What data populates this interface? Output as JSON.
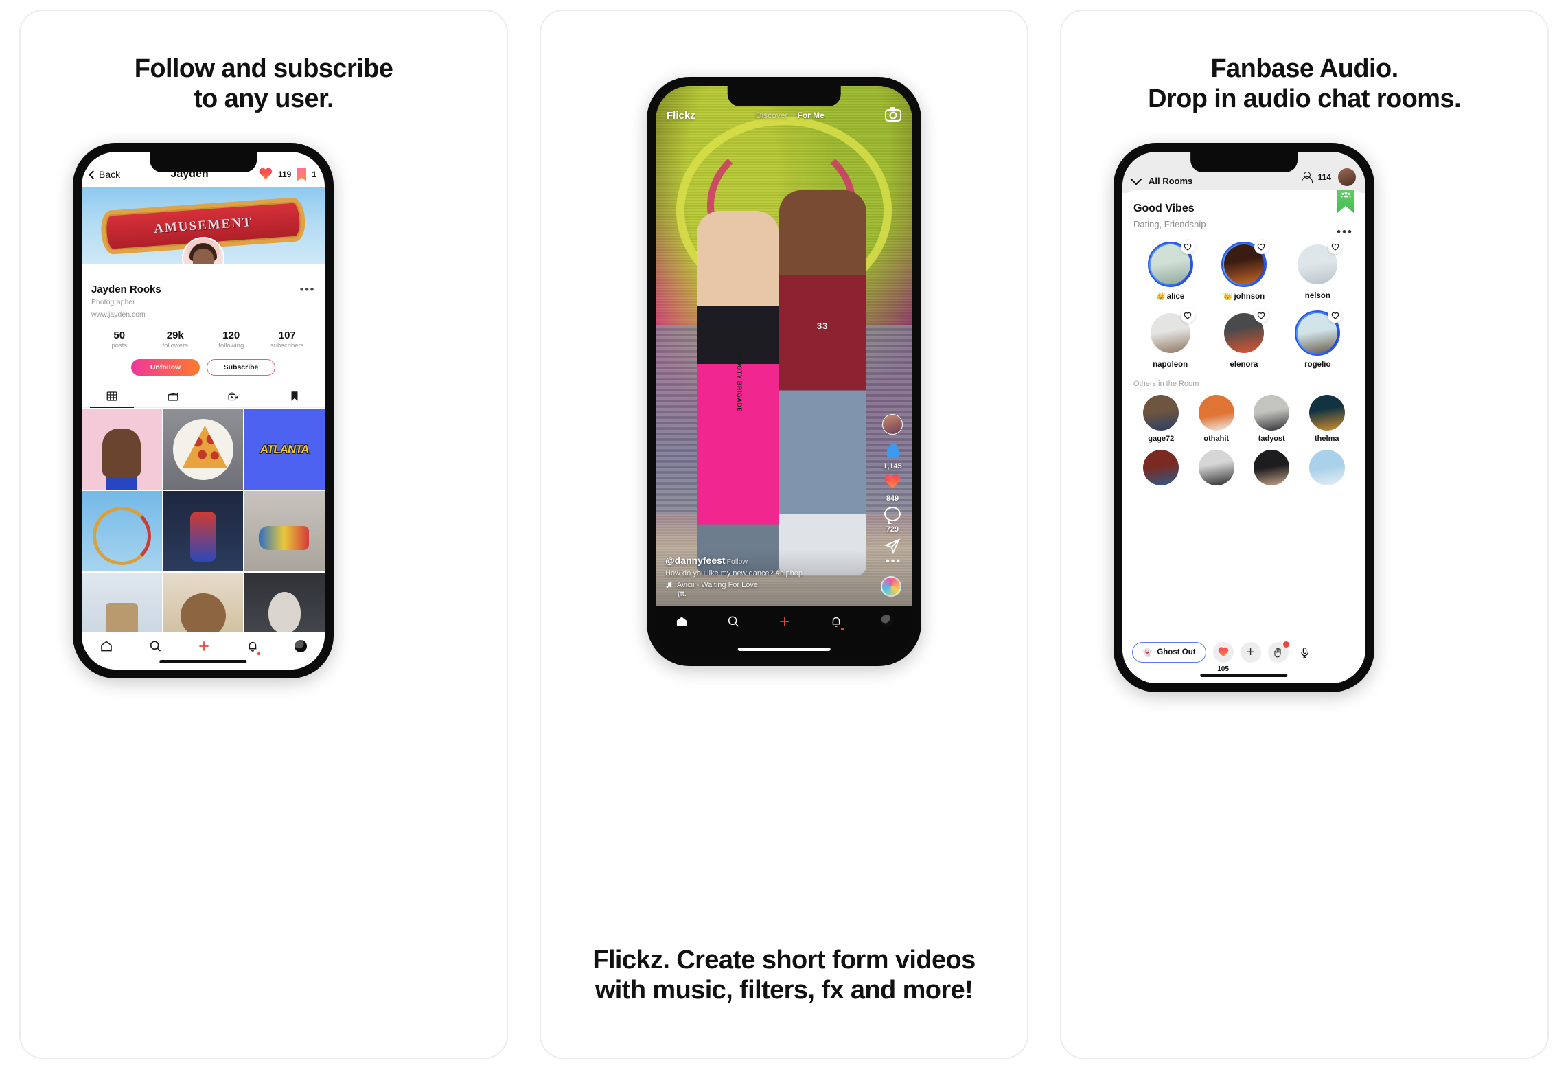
{
  "panels": [
    {
      "headline_lines": [
        "Follow and subscribe",
        "to any user."
      ],
      "phone": {
        "topbar": {
          "back_label": "Back",
          "title": "Jayden",
          "like_count": "119",
          "bookmark_count": "1"
        },
        "banner_text": "AMUSEMENT",
        "profile": {
          "name": "Jayden Rooks",
          "role": "Photographer",
          "website": "www.jayden.com",
          "more_label": "•••"
        },
        "stats": [
          {
            "value": "50",
            "label": "posts"
          },
          {
            "value": "29k",
            "label": "followers"
          },
          {
            "value": "120",
            "label": "following"
          },
          {
            "value": "107",
            "label": "subscribers"
          }
        ],
        "actions": {
          "unfollow_label": "Unfollow",
          "subscribe_label": "Subscribe"
        },
        "tabs": [
          {
            "icon": "grid-icon",
            "active": true
          },
          {
            "icon": "clapperboard-icon",
            "active": false
          },
          {
            "icon": "tv-plus-icon",
            "active": false
          },
          {
            "icon": "bookmark-icon",
            "active": false
          }
        ],
        "grid_items": [
          {
            "name": "portrait-photo",
            "kind": "g-portrait",
            "caption": ""
          },
          {
            "name": "pizza-photo",
            "kind": "g-pizza",
            "caption": ""
          },
          {
            "name": "atlanta-graffiti-photo",
            "kind": "g-atlanta",
            "caption": "ATLANTA"
          },
          {
            "name": "rollercoaster-photo",
            "kind": "g-coaster",
            "caption": ""
          },
          {
            "name": "figure-photo",
            "kind": "g-figure",
            "caption": ""
          },
          {
            "name": "sneakers-photo",
            "kind": "g-sneaker",
            "caption": ""
          },
          {
            "name": "beach-photo",
            "kind": "g-sand",
            "caption": ""
          },
          {
            "name": "food-photo",
            "kind": "g-food",
            "caption": ""
          },
          {
            "name": "face-photo",
            "kind": "g-face2",
            "caption": ""
          }
        ],
        "nav": [
          "home-icon",
          "search-icon",
          "add-icon",
          "bell-icon",
          "profile-avatar"
        ]
      }
    },
    {
      "footline_lines": [
        "Flickz. Create short form videos",
        "with music, filters, fx and more!"
      ],
      "phone": {
        "topbar": {
          "logo": "Flickz",
          "tabs": [
            {
              "label": "Discover",
              "active": false
            },
            {
              "label": "For Me",
              "active": true
            }
          ],
          "camera_icon": "camera-icon"
        },
        "overlay_text": "#BOOTY BRIGADE",
        "rail": [
          {
            "icon": "thumbs-up-icon",
            "count": "1,145"
          },
          {
            "icon": "heart-icon",
            "count": "849"
          },
          {
            "icon": "comment-icon",
            "count": "729"
          },
          {
            "icon": "send-icon",
            "count": ""
          }
        ],
        "caption": {
          "handle": "@dannyfeest",
          "follow_label": "Follow",
          "more_label": "•••",
          "text": "How do you like my new dance? #hiphop",
          "music": "Avicii - Waiting For Love",
          "music_ft": "(ft."
        },
        "nav": [
          "home-icon",
          "search-icon",
          "add-icon",
          "bell-icon",
          "profile-avatar"
        ]
      }
    },
    {
      "headline_lines": [
        "Fanbase Audio.",
        "Drop in audio chat rooms."
      ],
      "phone": {
        "header": {
          "all_rooms_label": "All Rooms",
          "listener_count": "114"
        },
        "room": {
          "name": "Good Vibes",
          "tags": "Dating, Friendship",
          "more_label": "•••",
          "badge_icon": "group-icon"
        },
        "speakers": [
          {
            "name": "alice",
            "crown": "gold",
            "ring": true,
            "av": "av1"
          },
          {
            "name": "johnson",
            "crown": "green",
            "ring": true,
            "av": "av2"
          },
          {
            "name": "nelson",
            "crown": "",
            "ring": false,
            "av": "av3"
          },
          {
            "name": "napoleon",
            "crown": "",
            "ring": false,
            "av": "av4"
          },
          {
            "name": "elenora",
            "crown": "",
            "ring": false,
            "av": "av5"
          },
          {
            "name": "rogelio",
            "crown": "",
            "ring": true,
            "av": "av6"
          }
        ],
        "others_label": "Others in the Room",
        "others": [
          {
            "name": "gage72",
            "av": "av7"
          },
          {
            "name": "othahit",
            "av": "av8"
          },
          {
            "name": "tadyost",
            "av": "av9"
          },
          {
            "name": "thelma",
            "av": "av10"
          },
          {
            "name": "",
            "av": "av11"
          },
          {
            "name": "",
            "av": "av12"
          },
          {
            "name": "",
            "av": "av13"
          },
          {
            "name": "",
            "av": "av14"
          }
        ],
        "bottom": {
          "ghost_label": "Ghost Out",
          "ghost_emoji": "👻",
          "heart_count": "105",
          "plus_label": "+",
          "hand_emoji": "✋",
          "mic_icon": "mic-icon"
        }
      }
    }
  ],
  "colors": {
    "accent_pink": "#f0379a",
    "accent_orange": "#ff7a2f",
    "accent_red": "#f0453a",
    "ring_blue": "#2b57e8",
    "badge_green": "#49bb55",
    "thumb_blue": "#3b9bf0"
  }
}
